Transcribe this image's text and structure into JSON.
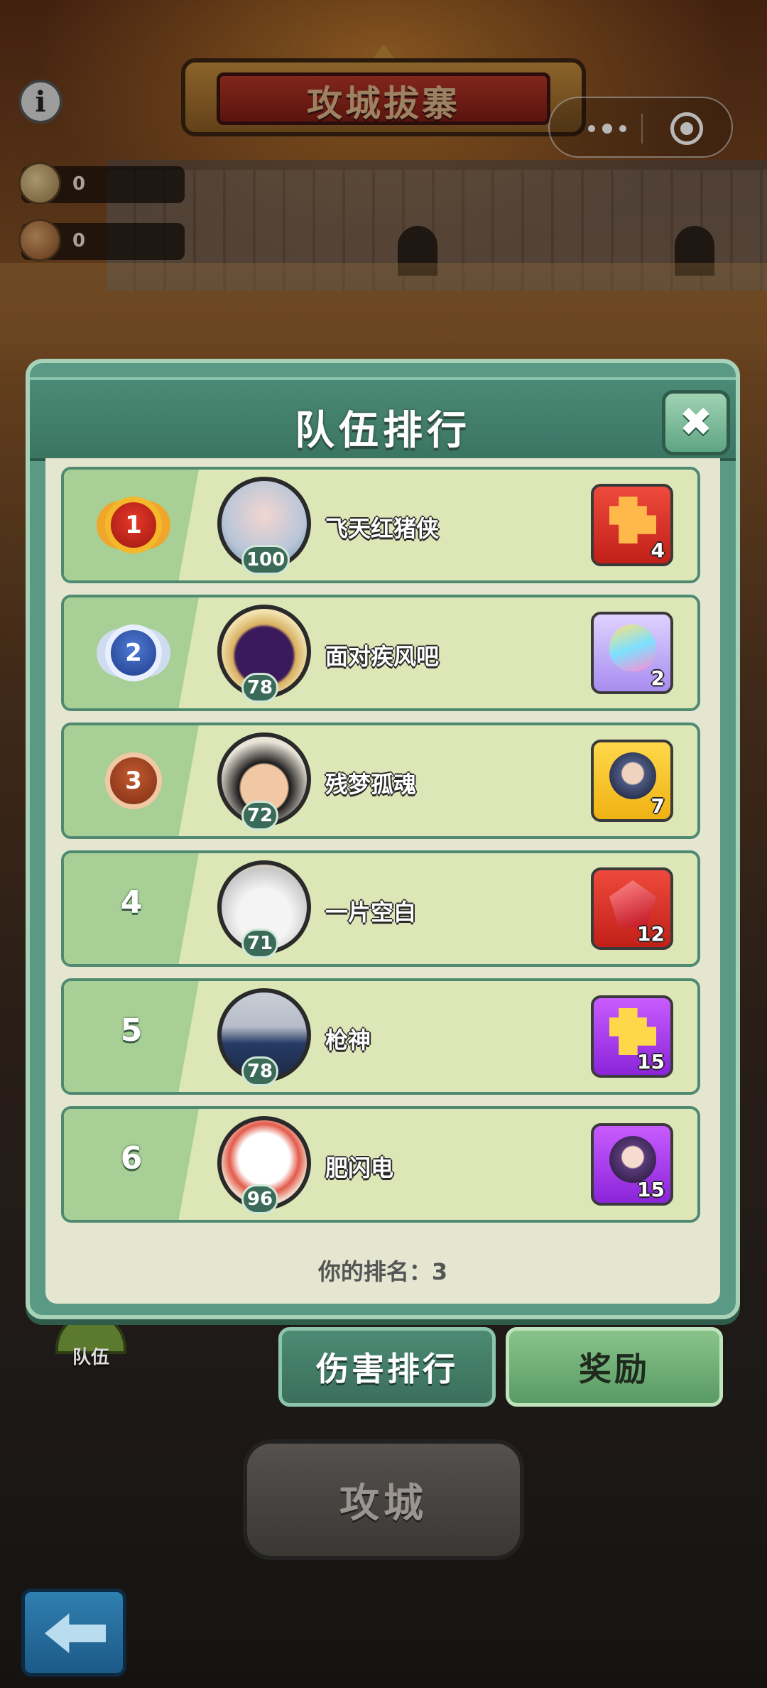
{
  "header": {
    "title": "攻城拔寨",
    "resources": [
      {
        "icon": "stone-resource-icon",
        "value": "0"
      },
      {
        "icon": "scroll-resource-icon",
        "value": "0"
      }
    ]
  },
  "side": {
    "team_label": "队伍"
  },
  "panel": {
    "title": "队伍排行",
    "close_icon": "close-icon",
    "your_rank": "你的排名：3",
    "rows": [
      {
        "rank": "1",
        "medal": "gold",
        "level": "100",
        "name": "飞天红猪侠",
        "reward_color": "#e0302a",
        "reward_icon": "puzzle-icon",
        "reward_qty": "4"
      },
      {
        "rank": "2",
        "medal": "silver",
        "level": "78",
        "name": "面对疾风吧",
        "reward_color": "#b79cf2",
        "reward_icon": "egg-icon",
        "reward_qty": "2"
      },
      {
        "rank": "3",
        "medal": "bronze",
        "level": "72",
        "name": "残梦孤魂",
        "reward_color": "#f4c020",
        "reward_icon": "hero-piece-icon",
        "reward_qty": "7"
      },
      {
        "rank": "4",
        "medal": "none",
        "level": "71",
        "name": "一片空白",
        "reward_color": "#e0302a",
        "reward_icon": "gem-icon",
        "reward_qty": "12"
      },
      {
        "rank": "5",
        "medal": "none",
        "level": "78",
        "name": "枪神",
        "reward_color": "#a43ae6",
        "reward_icon": "puzzle-icon",
        "reward_qty": "15"
      },
      {
        "rank": "6",
        "medal": "none",
        "level": "96",
        "name": "肥闪电",
        "reward_color": "#a43ae6",
        "reward_icon": "hero-piece-icon",
        "reward_qty": "15"
      }
    ]
  },
  "tabs": {
    "damage": "伤害排行",
    "reward": "奖励"
  },
  "buttons": {
    "attack": "攻城"
  }
}
